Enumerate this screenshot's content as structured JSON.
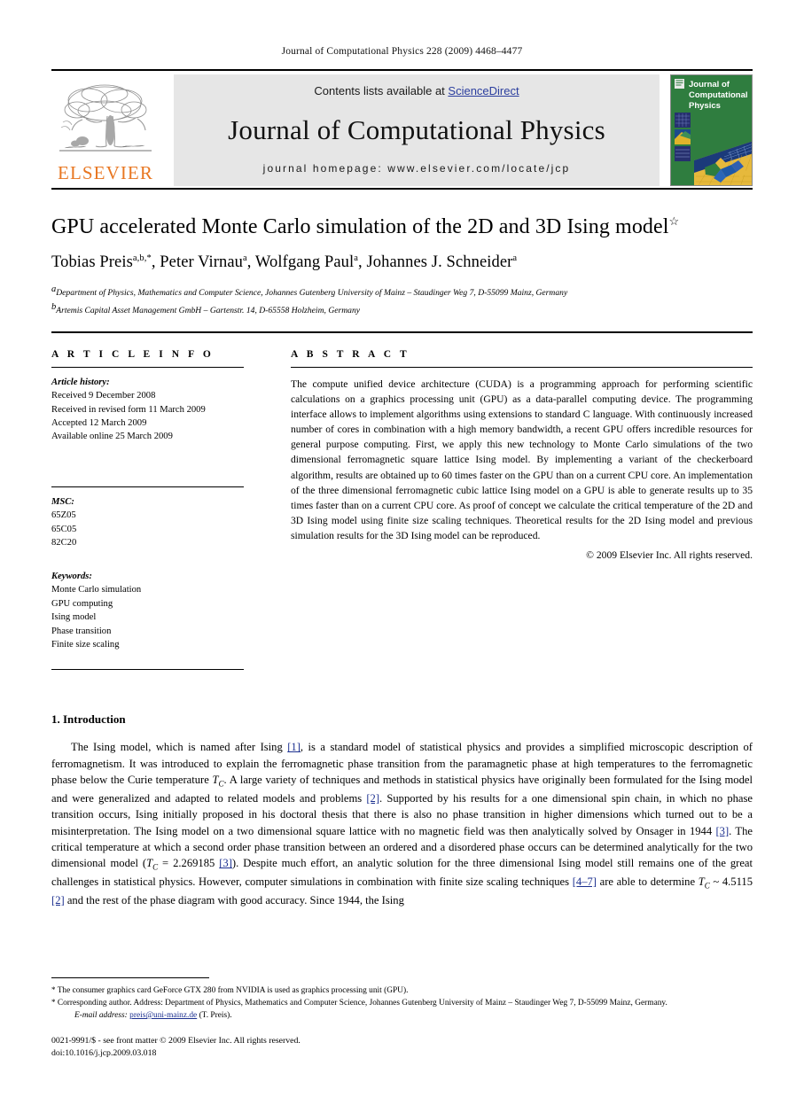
{
  "running_head": "Journal of Computational Physics 228 (2009) 4468–4477",
  "masthead": {
    "publisher_name": "ELSEVIER",
    "contents_prefix": "Contents lists available at ",
    "sciencedirect": "ScienceDirect",
    "journal_title": "Journal of Computational Physics",
    "homepage": "journal homepage: www.elsevier.com/locate/jcp",
    "cover_title_line1": "Journal of",
    "cover_title_line2": "Computational",
    "cover_title_line3": "Physics",
    "sciencedirect_color": "#2a3d9e",
    "elsevier_orange": "#E87722",
    "banner_background": "#e6e6e6",
    "cover_green": "#2f7d3f"
  },
  "article": {
    "title": "GPU accelerated Monte Carlo simulation of the 2D and 3D Ising model",
    "title_footnote_mark": "☆",
    "authors": "Tobias Preis a,b,*, Peter Virnau a, Wolfgang Paul a, Johannes J. Schneider a",
    "author_list": [
      {
        "name": "Tobias Preis",
        "marks": "a,b,*"
      },
      {
        "name": "Peter Virnau",
        "marks": "a"
      },
      {
        "name": "Wolfgang Paul",
        "marks": "a"
      },
      {
        "name": "Johannes J. Schneider",
        "marks": "a"
      }
    ],
    "affiliations": [
      {
        "mark": "a",
        "text": "Department of Physics, Mathematics and Computer Science, Johannes Gutenberg University of Mainz – Staudinger Weg 7, D-55099 Mainz, Germany"
      },
      {
        "mark": "b",
        "text": "Artemis Capital Asset Management GmbH – Gartenstr. 14, D-65558 Holzheim, Germany"
      }
    ]
  },
  "article_info": {
    "heading": "A R T I C L E    I N F O",
    "history_label": "Article history:",
    "history": [
      "Received 9 December 2008",
      "Received in revised form 11 March 2009",
      "Accepted 12 March 2009",
      "Available online 25 March 2009"
    ],
    "msc_label": "MSC:",
    "msc": [
      "65Z05",
      "65C05",
      "82C20"
    ],
    "keywords_label": "Keywords:",
    "keywords": [
      "Monte Carlo simulation",
      "GPU computing",
      "Ising model",
      "Phase transition",
      "Finite size scaling"
    ]
  },
  "abstract": {
    "heading": "A B S T R A C T",
    "text": "The compute unified device architecture (CUDA) is a programming approach for performing scientific calculations on a graphics processing unit (GPU) as a data-parallel computing device. The programming interface allows to implement algorithms using extensions to standard C language. With continuously increased number of cores in combination with a high memory bandwidth, a recent GPU offers incredible resources for general purpose computing. First, we apply this new technology to Monte Carlo simulations of the two dimensional ferromagnetic square lattice Ising model. By implementing a variant of the checkerboard algorithm, results are obtained up to 60 times faster on the GPU than on a current CPU core. An implementation of the three dimensional ferromagnetic cubic lattice Ising model on a GPU is able to generate results up to 35 times faster than on a current CPU core. As proof of concept we calculate the critical temperature of the 2D and 3D Ising model using finite size scaling techniques. Theoretical results for the 2D Ising model and previous simulation results for the 3D Ising model can be reproduced.",
    "copyright": "© 2009 Elsevier Inc. All rights reserved."
  },
  "introduction": {
    "heading": "1. Introduction",
    "paragraph_parts": [
      "The Ising model, which is named after Ising ",
      "[1]",
      ", is a standard model of statistical physics and provides a simplified microscopic description of ferromagnetism. It was introduced to explain the ferromagnetic phase transition from the paramagnetic phase at high temperatures to the ferromagnetic phase below the Curie temperature ",
      "T",
      "C",
      ". A large variety of techniques and methods in statistical physics have originally been formulated for the Ising model and were generalized and adapted to related models and problems ",
      "[2]",
      ". Supported by his results for a one dimensional spin chain, in which no phase transition occurs, Ising initially proposed in his doctoral thesis that there is also no phase transition in higher dimensions which turned out to be a misinterpretation. The Ising model on a two dimensional square lattice with no magnetic field was then analytically solved by Onsager in 1944 ",
      "[3]",
      ". The critical temperature at which a second order phase transition between an ordered and a disordered phase occurs can be determined analytically for the two dimensional model (",
      "T",
      "C",
      " = 2.269185 ",
      "[3]",
      "). Despite much effort, an analytic solution for the three dimensional Ising model still remains one of the great challenges in statistical physics. However, computer simulations in combination with finite size scaling techniques ",
      "[4–7]",
      " are able to determine ",
      "T",
      "C",
      " ~ 4.5115 ",
      "[2]",
      " and the rest of the phase diagram with good accuracy. Since 1944, the Ising"
    ]
  },
  "footnotes": {
    "star_mark": "*",
    "star_text": "The consumer graphics card GeForce GTX 280 from NVIDIA is used as graphics processing unit (GPU).",
    "corresponding_mark": "*",
    "corresponding_text": "Corresponding author. Address: Department of Physics, Mathematics and Computer Science, Johannes Gutenberg University of Mainz – Staudinger Weg 7, D-55099 Mainz, Germany.",
    "email_label": "E-mail address:",
    "email": "preis@uni-mainz.de",
    "email_suffix": "(T. Preis)."
  },
  "imprint": {
    "issn_line": "0021-9991/$ - see front matter © 2009 Elsevier Inc. All rights reserved.",
    "doi_line": "doi:10.1016/j.jcp.2009.03.018"
  }
}
